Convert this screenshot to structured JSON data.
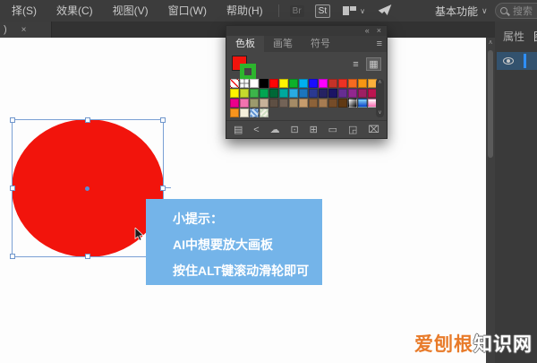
{
  "menu_bar": {
    "items": [
      "择(S)",
      "效果(C)",
      "视图(V)",
      "窗口(W)",
      "帮助(H)"
    ],
    "br_badge": "Br",
    "st_badge": "St",
    "workspace": "基本功能",
    "workspace_chevron": "∨",
    "search_placeholder": "搜索"
  },
  "document_tab": {
    "label_fragment": ")",
    "close": "×"
  },
  "swatches_panel": {
    "collapse_icon": "«",
    "close_icon": "×",
    "menu_icon": "≡",
    "tabs": [
      {
        "label": "色板",
        "active": true
      },
      {
        "label": "画笔",
        "active": false
      },
      {
        "label": "符号",
        "active": false
      }
    ],
    "fill_color": "#f2140c",
    "stroke_color": "#2db52d",
    "view_list_icon": "≡",
    "view_grid_icon": "▦",
    "scroll_up": "∧",
    "scroll_down": "∨",
    "grid_rows": [
      [
        "none",
        "reg",
        "#ffffff",
        "#000000",
        "#ff0606",
        "#fff500",
        "#0db02b",
        "#00b0f0",
        "#1a0dff",
        "#ff00ff",
        "#c53228",
        "#ee3124",
        "#f76b20",
        "#f79613",
        "#fbb03b"
      ],
      [
        "#fff200",
        "#c5d92d",
        "#3cb44a",
        "#00a551",
        "#006837",
        "#00a99d",
        "#29abe2",
        "#1c75bc",
        "#2b3990",
        "#262262",
        "#1b1464",
        "#662d91",
        "#92278f",
        "#9e1f63",
        "#bd1550"
      ],
      [
        "#ec008c",
        "#f272af",
        "#9c9a6d",
        "#c7b299",
        "#5e4f43",
        "#736357",
        "#a48b66",
        "#c69c6d",
        "#8c6239",
        "#a67c52",
        "#754c29",
        "#603913",
        "gbw",
        "gblue",
        "gpink"
      ],
      [
        "#f7941d",
        "#f5f0dc",
        "pat1",
        "pat2"
      ]
    ],
    "bottom_icons": [
      {
        "name": "swatch-libraries-icon",
        "glyph": "▤"
      },
      {
        "name": "add-to-library-icon",
        "glyph": "<"
      },
      {
        "name": "color-themes-icon",
        "glyph": "☁"
      },
      {
        "name": "swatch-kinds-icon",
        "glyph": "⊡"
      },
      {
        "name": "swatch-options-icon",
        "glyph": "⊞"
      },
      {
        "name": "new-color-group-icon",
        "glyph": "▭"
      },
      {
        "name": "new-swatch-icon",
        "glyph": "◲"
      },
      {
        "name": "delete-swatch-icon",
        "glyph": "⌧"
      }
    ]
  },
  "right_panel": {
    "tabs": [
      {
        "label": "属性"
      },
      {
        "label": "图"
      }
    ]
  },
  "canvas": {
    "shape_fill": "#f2140c",
    "selection_color": "#7aa0d4",
    "tip_box": {
      "bg": "#74b4e9",
      "lines": [
        "小提示：",
        "AI中想要放大画板",
        "按住ALT键滚动滑轮即可"
      ]
    }
  },
  "scrollbar_up": "∧",
  "watermark": {
    "part1": "爱刨根",
    "part2": "知识网",
    "color1": "#e87b2a",
    "color2": "#ffffff"
  }
}
